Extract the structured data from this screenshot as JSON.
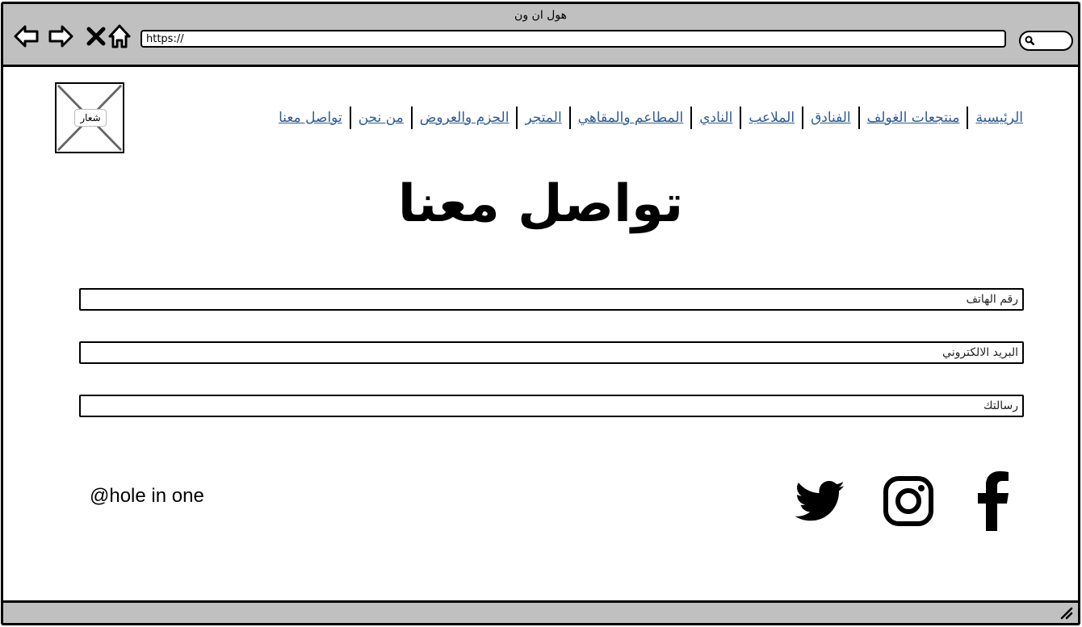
{
  "browser": {
    "window_title": "هول ان ون",
    "url": "https://",
    "icons": {
      "back": "back-arrow-icon",
      "forward": "forward-arrow-icon",
      "stop": "close-icon",
      "home": "home-icon",
      "search": "search-icon"
    }
  },
  "logo": {
    "label": "شعار"
  },
  "nav": {
    "items": [
      {
        "label": "الرئيسية"
      },
      {
        "label": "منتجعات الغولف"
      },
      {
        "label": "الفنادق"
      },
      {
        "label": "الملاعب"
      },
      {
        "label": "النادي"
      },
      {
        "label": "المطاعم والمقاهي"
      },
      {
        "label": "المتجر"
      },
      {
        "label": "الحزم والعروض"
      },
      {
        "label": "من نحن"
      },
      {
        "label": "تواصل معنا"
      }
    ],
    "link_color": "#2c5b94"
  },
  "page": {
    "title": "تواصل معنا"
  },
  "form": {
    "phone_placeholder": "رقم الهاتف",
    "email_placeholder": "البريد الالكتروني",
    "message_placeholder": "رسالتك"
  },
  "footer": {
    "handle": "@hole in one",
    "social": [
      "twitter-icon",
      "instagram-icon",
      "facebook-icon"
    ]
  },
  "colors": {
    "chrome": "#c0c0c0",
    "border": "#000000"
  }
}
